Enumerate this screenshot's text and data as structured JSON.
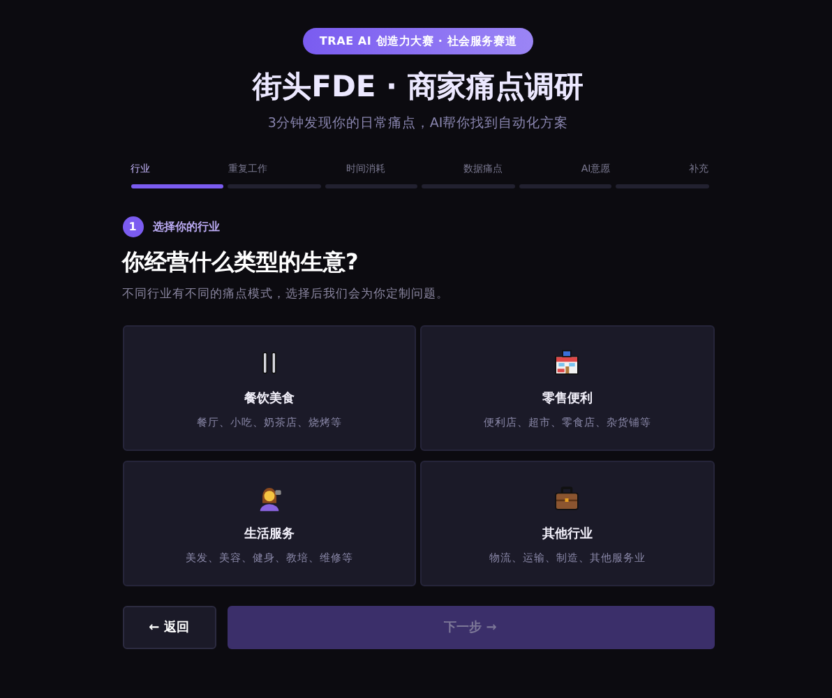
{
  "badge": "TRAE AI 创造力大赛 · 社会服务赛道",
  "title": "街头FDE · 商家痛点调研",
  "subtitle": "3分钟发现你的日常痛点，AI帮你找到自动化方案",
  "tabs": [
    {
      "label": "行业",
      "selected": true
    },
    {
      "label": "重复工作",
      "selected": false
    },
    {
      "label": "时间消耗",
      "selected": false
    },
    {
      "label": "数据痛点",
      "selected": false
    },
    {
      "label": "AI意愿",
      "selected": false
    },
    {
      "label": "补充",
      "selected": false
    }
  ],
  "step": {
    "number": "1",
    "label": "选择你的行业"
  },
  "question": "你经营什么类型的生意?",
  "hint": "不同行业有不同的痛点模式，选择后我们会为你定制问题。",
  "options": [
    {
      "kind": "food",
      "title": "餐饮美食",
      "desc": "餐厅、小吃、奶茶店、烧烤等",
      "selected": false
    },
    {
      "kind": "retail",
      "title": "零售便利",
      "desc": "便利店、超市、零食店、杂货铺等",
      "selected": false
    },
    {
      "kind": "service",
      "title": "生活服务",
      "desc": "美发、美容、健身、教培、维修等",
      "selected": false
    },
    {
      "kind": "other",
      "title": "其他行业",
      "desc": "物流、运输、制造、其他服务业",
      "selected": false
    }
  ],
  "back_button": "← 返回",
  "next_button": {
    "label": "下一步 →",
    "disabled": true
  }
}
